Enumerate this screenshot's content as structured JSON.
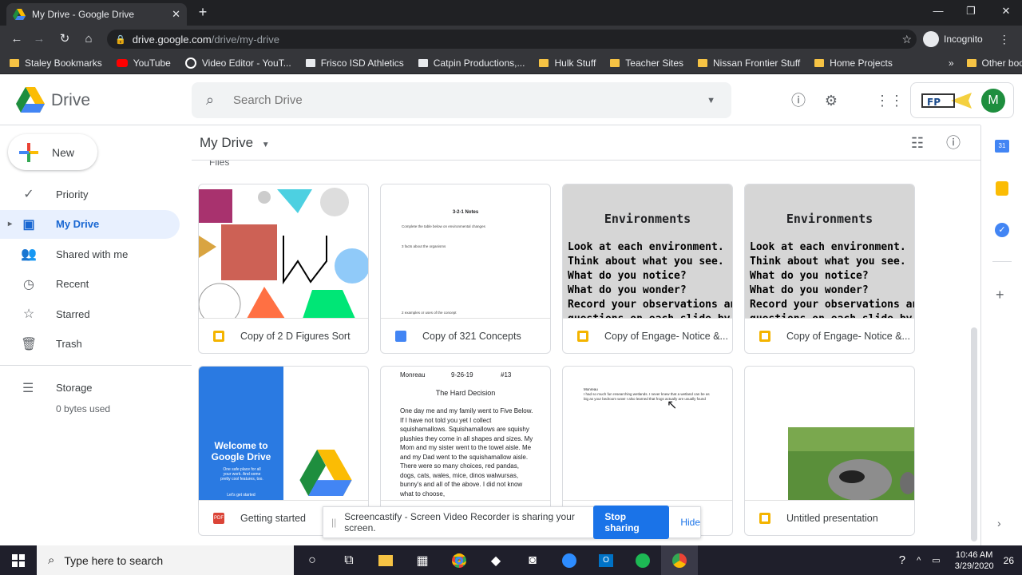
{
  "browser": {
    "tab_title": "My Drive - Google Drive",
    "url_host": "drive.google.com",
    "url_path": "/drive/my-drive",
    "profile": "Incognito",
    "bookmarks": [
      {
        "label": "Staley Bookmarks",
        "icon": "folder-icon"
      },
      {
        "label": "YouTube",
        "icon": "youtube-icon"
      },
      {
        "label": "Video Editor - YouT...",
        "icon": "google-icon"
      },
      {
        "label": "Frisco ISD Athletics",
        "icon": "page-icon"
      },
      {
        "label": "Catpin Productions,...",
        "icon": "page-icon"
      },
      {
        "label": "Hulk Stuff",
        "icon": "folder-icon"
      },
      {
        "label": "Teacher Sites",
        "icon": "folder-icon"
      },
      {
        "label": "Nissan Frontier Stuff",
        "icon": "folder-icon"
      },
      {
        "label": "Home Projects",
        "icon": "folder-icon"
      }
    ],
    "overflow": "»",
    "other_bookmarks": "Other bookmarks"
  },
  "drive": {
    "product": "Drive",
    "search_placeholder": "Search Drive",
    "avatar_letter": "M",
    "new_label": "New",
    "nav": [
      {
        "label": "Priority",
        "icon": "priority-icon",
        "active": false
      },
      {
        "label": "My Drive",
        "icon": "my-drive-icon",
        "active": true
      },
      {
        "label": "Shared with me",
        "icon": "shared-icon",
        "active": false
      },
      {
        "label": "Recent",
        "icon": "clock-icon",
        "active": false
      },
      {
        "label": "Starred",
        "icon": "star-icon",
        "active": false
      },
      {
        "label": "Trash",
        "icon": "trash-icon",
        "active": false
      }
    ],
    "storage_label": "Storage",
    "storage_used": "0 bytes used",
    "location_title": "My Drive",
    "section_label": "Files",
    "files": [
      {
        "name": "Copy of 2 D Figures Sort",
        "type": "slides"
      },
      {
        "name": "Copy of 321 Concepts",
        "type": "doc"
      },
      {
        "name": "Copy of Engage- Notice &...",
        "type": "slides"
      },
      {
        "name": "Copy of Engage- Notice &...",
        "type": "slides"
      },
      {
        "name": "Getting started",
        "type": "pdf"
      },
      {
        "name": "",
        "type": "doc"
      },
      {
        "name": "",
        "type": "doc"
      },
      {
        "name": "Untitled presentation",
        "type": "slides"
      }
    ],
    "thumbs": {
      "doc321_title": "3-2-1 Notes",
      "doc321_line1": "Complete the table below on environmental changes",
      "doc321_line2": "3 facts about the organisms",
      "doc321_line3": "2 examples or uses of the concept",
      "env_title": "Environments",
      "env_lines": "Look at each environment.\nThink about what you see.\nWhat do you notice?\nWhat do you wonder?\nRecord your observations and\nquestions on each slide by add",
      "welcome_title": "Welcome to\nGoogle Drive",
      "welcome_sub": "One safe place for all your work. And some pretty cool features, too.",
      "welcome_cta": "Let's get started",
      "essay_name": "Monreau",
      "essay_date": "9-26-19",
      "essay_num": "#13",
      "essay_title": "The Hard Decision",
      "essay_body": "One day me and my family went to Five Below. If I have not told you yet I collect squishamallows. Squishamallows are squishy plushies they come in all shapes and sizes. My Mom and my sister went to the towel aisle. Me and my Dad went to the squishamallow aisle. There were so many choices, red pandas, dogs, cats, wales, mice, dinos walwursas, bunny's and all of the above. I did not know what to choose,",
      "notes_name": "Monreau",
      "notes_body": "I had so much fun researching wetlands. I never knew that a wetland can be as big as your bedroom wow! I also learned that frogs actually are usually found"
    }
  },
  "share_banner": {
    "handle": "||",
    "message": "Screencastify - Screen Video Recorder is sharing your screen.",
    "stop_label": "Stop sharing",
    "hide_label": "Hide"
  },
  "taskbar": {
    "search_placeholder": "Type here to search",
    "time": "10:46 AM",
    "date": "3/29/2020",
    "notifications": "26"
  }
}
